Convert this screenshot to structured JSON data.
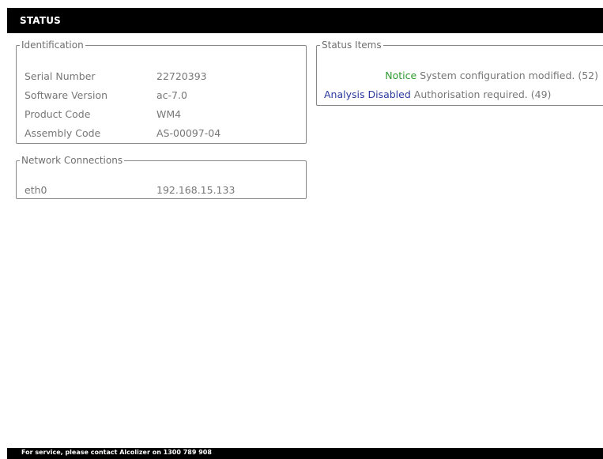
{
  "header": {
    "title": "STATUS"
  },
  "identification": {
    "legend": "Identification",
    "rows": [
      {
        "label": "Serial Number",
        "value": "22720393"
      },
      {
        "label": "Software Version",
        "value": "ac-7.0"
      },
      {
        "label": "Product Code",
        "value": "WM4"
      },
      {
        "label": "Assembly Code",
        "value": "AS-00097-04"
      }
    ]
  },
  "network": {
    "legend": "Network Connections",
    "rows": [
      {
        "label": "eth0",
        "value": "192.168.15.133"
      }
    ]
  },
  "status_items": {
    "legend": "Status Items",
    "items": [
      {
        "level": "Notice",
        "message": "System configuration modified. (52)",
        "level_color": "#2f9a2f"
      },
      {
        "level": "Analysis Disabled",
        "message": "Authorisation required. (49)",
        "level_color": "#2a3a9c"
      }
    ]
  },
  "footer": {
    "text": "For service, please contact Alcolizer on 1300 789 908"
  }
}
